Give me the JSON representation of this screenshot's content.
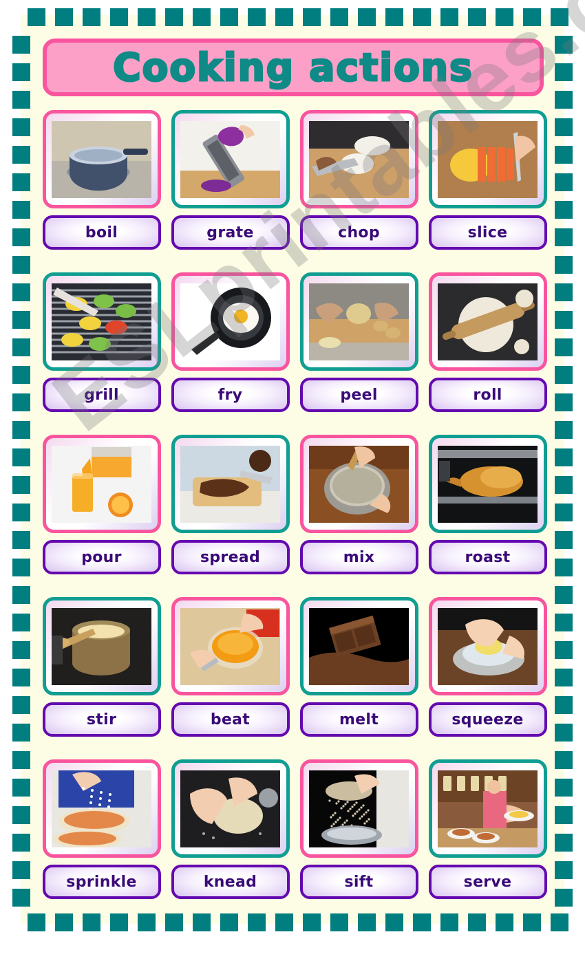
{
  "title": {
    "text": "Cooking actions",
    "banner_fill": "#fda0c8",
    "banner_border": "#f9559e",
    "text_outline": "#0f8a86"
  },
  "watermark": {
    "text": "ESLprintables.com"
  },
  "theme": {
    "page_bg": "#ffffff",
    "field_bg": "#fdfce4",
    "dash_color": "#017e80",
    "frame_pink": "#f9559e",
    "frame_teal": "#119e92",
    "label_border": "#6409b0",
    "label_text": "#3a0a78"
  },
  "grid": {
    "columns": 4,
    "rows": 5,
    "cards": [
      {
        "word": "boil",
        "frame": "pink",
        "image": "pot-boiling-water-on-stove"
      },
      {
        "word": "grate",
        "frame": "teal",
        "image": "hand-grating-red-cabbage"
      },
      {
        "word": "chop",
        "frame": "pink",
        "image": "knife-chopping-onion-on-board"
      },
      {
        "word": "slice",
        "frame": "teal",
        "image": "knife-slicing-mango"
      },
      {
        "word": "grill",
        "frame": "teal",
        "image": "peppers-and-meat-on-grill"
      },
      {
        "word": "fry",
        "frame": "pink",
        "image": "fried-egg-in-frying-pan"
      },
      {
        "word": "peel",
        "frame": "teal",
        "image": "hands-peeling-potato"
      },
      {
        "word": "roll",
        "frame": "pink",
        "image": "rolling-pin-flattening-dough"
      },
      {
        "word": "pour",
        "frame": "pink",
        "image": "orange-juice-poured-into-glass"
      },
      {
        "word": "spread",
        "frame": "teal",
        "image": "knife-spreading-chocolate-on-toast"
      },
      {
        "word": "mix",
        "frame": "pink",
        "image": "hands-mixing-bowl-with-spoon"
      },
      {
        "word": "roast",
        "frame": "teal",
        "image": "roast-chicken-in-oven"
      },
      {
        "word": "stir",
        "frame": "teal",
        "image": "wooden-spoon-stirring-pot"
      },
      {
        "word": "beat",
        "frame": "pink",
        "image": "whisk-beating-eggs-in-bowl"
      },
      {
        "word": "melt",
        "frame": "teal",
        "image": "melting-chocolate-bar"
      },
      {
        "word": "squeeze",
        "frame": "pink",
        "image": "hand-squeezing-lemon-on-juicer"
      },
      {
        "word": "sprinkle",
        "frame": "pink",
        "image": "hand-sprinkling-cheese-on-pizza"
      },
      {
        "word": "knead",
        "frame": "teal",
        "image": "hands-kneading-dough"
      },
      {
        "word": "sift",
        "frame": "pink",
        "image": "sieve-sifting-flour"
      },
      {
        "word": "serve",
        "frame": "teal",
        "image": "waiter-serving-plates-of-food"
      }
    ]
  }
}
